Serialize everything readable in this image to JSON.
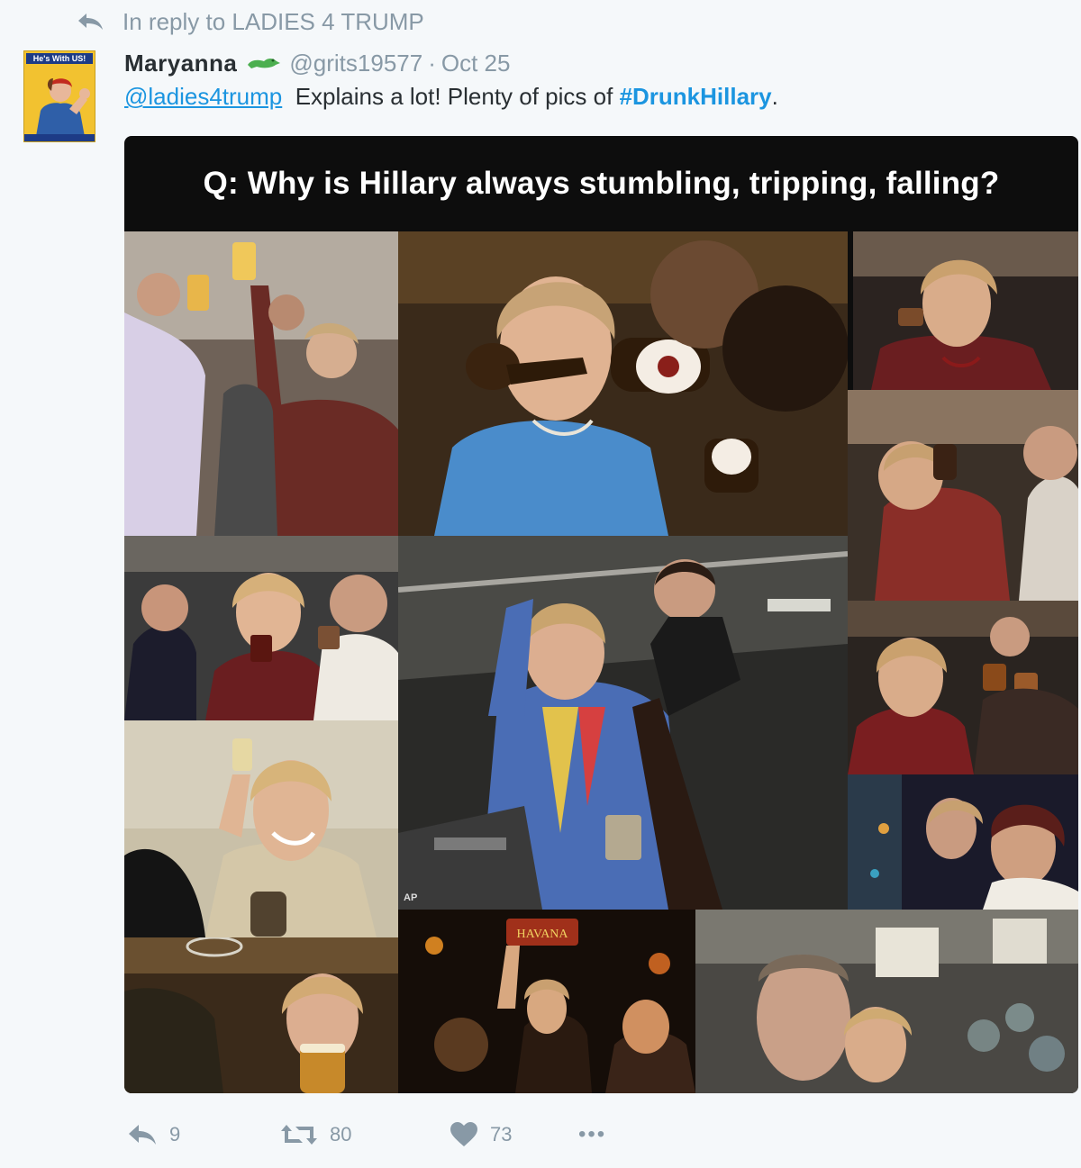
{
  "reply_context": {
    "icon": "reply-arrow-icon",
    "text": "In reply to LADIES 4 TRUMP"
  },
  "tweet": {
    "author": {
      "name": "Maryanna",
      "handle": "@grits19577",
      "badge_icon": "crocodile-icon",
      "avatar_banner": "He's With US!"
    },
    "separator": "·",
    "date": "Oct 25",
    "text": {
      "mention": "@ladies4trump",
      "body": "Explains a lot! Plenty of pics of",
      "hashtag": "#DrunkHillary",
      "end": "."
    },
    "media": {
      "caption": "Q: Why is Hillary always stumbling, tripping, falling?",
      "watermark": "AP",
      "label_text": "HAVANA"
    },
    "actions": {
      "reply": {
        "icon": "reply-icon",
        "count": "9"
      },
      "retweet": {
        "icon": "retweet-icon",
        "count": "80"
      },
      "like": {
        "icon": "heart-icon",
        "count": "73"
      },
      "more": {
        "icon": "more-dots-icon",
        "label": "•••"
      }
    }
  },
  "colors": {
    "background": "#f5f8fa",
    "link": "#1b95e0",
    "muted": "#8899a6",
    "text": "#292f33",
    "croc_green": "#4caf50"
  }
}
